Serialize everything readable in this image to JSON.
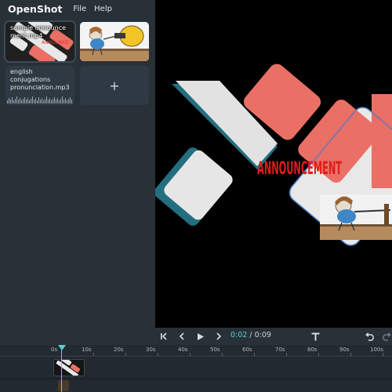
{
  "app": {
    "title": "OpenShot"
  },
  "menu": {
    "items": [
      "File",
      "Help"
    ]
  },
  "library": {
    "files": [
      {
        "label": "sample announcement.mp4",
        "kind": "video"
      },
      {
        "label": "",
        "kind": "image"
      },
      {
        "label": "english conjugations pronunciation.mp3",
        "kind": "audio"
      }
    ],
    "add_label": "+"
  },
  "preview": {
    "overlay_text": "ANNOUNCEMENT"
  },
  "transport": {
    "current": "0:02",
    "separator": " / ",
    "duration": "0:09"
  },
  "timeline": {
    "ruler_labels": [
      "0s",
      "10s",
      "20s",
      "30s",
      "40s",
      "50s",
      "60s",
      "70s",
      "80s",
      "90s",
      "100s"
    ]
  },
  "colors": {
    "accent": "#5ecfd6",
    "panel": "#283038",
    "shape_red": "#ea6f65",
    "shape_white": "#e8e8e8"
  },
  "icons": {
    "jump_start": "skip-start-icon",
    "prev": "chevron-left-icon",
    "play": "play-icon",
    "next": "chevron-right-icon",
    "title": "text-T-icon",
    "undo": "undo-icon",
    "redo": "redo-icon"
  }
}
